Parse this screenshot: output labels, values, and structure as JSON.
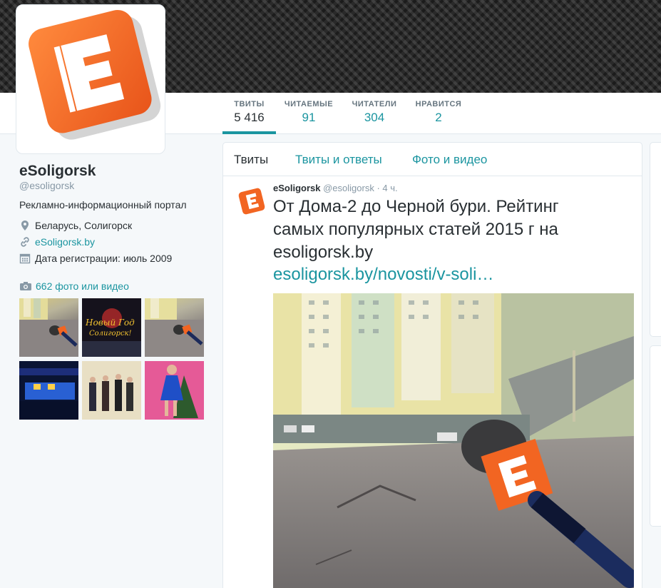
{
  "profile": {
    "name": "eSoligorsk",
    "handle": "@esoligorsk",
    "bio": "Рекламно-информационный портал",
    "location": "Беларусь, Солигорск",
    "url": "eSoligorsk.by",
    "joined": "Дата регистрации: июль 2009",
    "photos_label": "662 фото или видео"
  },
  "stats": [
    {
      "label": "ТВИТЫ",
      "value": "5 416"
    },
    {
      "label": "ЧИТАЕМЫЕ",
      "value": "91"
    },
    {
      "label": "ЧИТАТЕЛИ",
      "value": "304"
    },
    {
      "label": "НРАВИТСЯ",
      "value": "2"
    }
  ],
  "timeline_tabs": [
    "Твиты",
    "Твиты и ответы",
    "Фото и видео"
  ],
  "tweet": {
    "author": "eSoligorsk",
    "handle": "@esoligorsk",
    "time": "· 4 ч.",
    "text": "От Дома-2 до Черной бури. Рейтинг самых популярных статей 2015 г на esoligorsk.by",
    "link": "esoligorsk.by/novosti/v-soli…"
  },
  "thumb_texts": {
    "new_year": "Новый Год Солигорск!"
  },
  "colors": {
    "accent": "#1b95a0",
    "brand_orange": "#f26522",
    "background": "#f5f8fa"
  },
  "icons": [
    "location-icon",
    "link-icon",
    "calendar-icon",
    "camera-icon"
  ]
}
